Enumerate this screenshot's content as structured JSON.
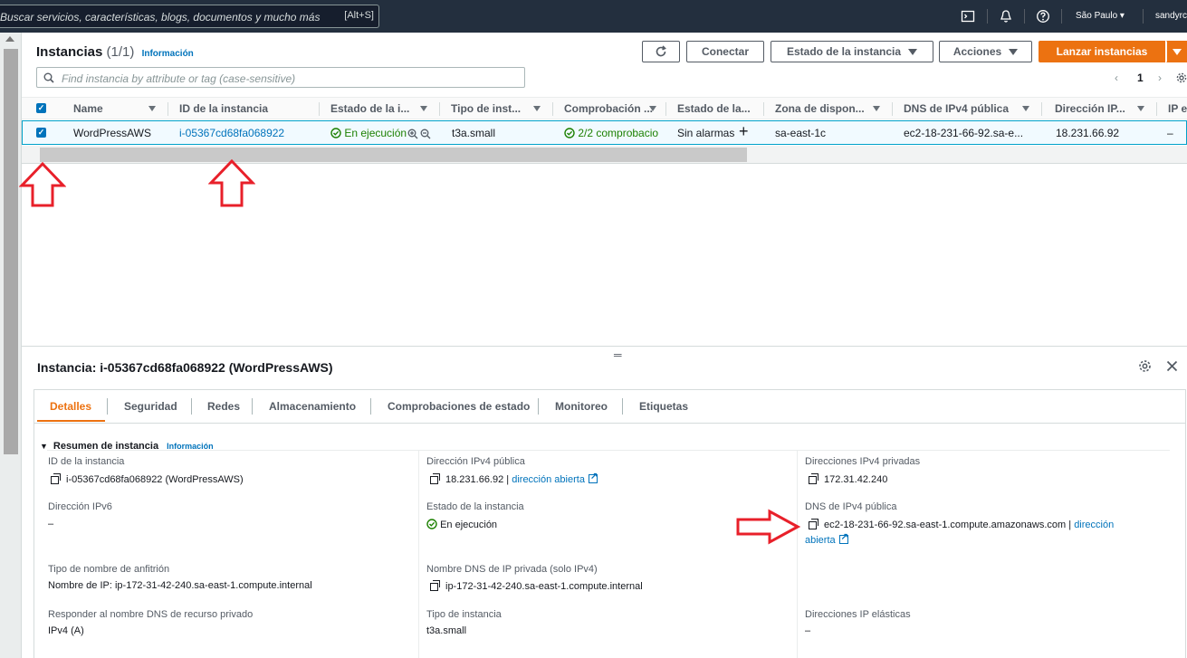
{
  "topbar": {
    "search_placeholder": "Buscar servicios, características, blogs, documentos y mucho más",
    "search_shortcut": "[Alt+S]",
    "region": "São Paulo ▾",
    "user": "sandyrc"
  },
  "header": {
    "title": "Instancias",
    "count": "(1/1)",
    "info": "Información",
    "buttons": {
      "refresh": "⟳",
      "connect": "Conectar",
      "instance_state": "Estado de la instancia",
      "actions": "Acciones",
      "launch": "Lanzar instancias"
    },
    "filter_placeholder": "Find instancia by attribute or tag (case-sensitive)",
    "page": "1"
  },
  "table": {
    "columns": [
      "Name",
      "ID de la instancia",
      "Estado de la i...",
      "Tipo de inst...",
      "Comprobación ...",
      "Estado de la...",
      "Zona de dispon...",
      "DNS de IPv4 pública",
      "Dirección IP...",
      "IP e"
    ],
    "row": {
      "name": "WordPressAWS",
      "id": "i-05367cd68fa068922",
      "state": "En ejecución",
      "type": "t3a.small",
      "checks": "2/2 comprobacio",
      "alarms": "Sin alarmas",
      "zone": "sa-east-1c",
      "dns": "ec2-18-231-66-92.sa-e...",
      "ip": "18.231.66.92",
      "ip_extra": "–"
    }
  },
  "details": {
    "title": "Instancia: i-05367cd68fa068922 (WordPressAWS)",
    "tabs": [
      "Detalles",
      "Seguridad",
      "Redes",
      "Almacenamiento",
      "Comprobaciones de estado",
      "Monitoreo",
      "Etiquetas"
    ],
    "section_title": "Resumen de instancia",
    "section_info": "Información",
    "fields": {
      "id_label": "ID de la instancia",
      "id_value": "i-05367cd68fa068922 (WordPressAWS)",
      "pub_ip_label": "Dirección IPv4 pública",
      "pub_ip_value": "18.231.66.92",
      "open_address": "dirección abierta",
      "priv_ip_label": "Direcciones IPv4 privadas",
      "priv_ip_value": "172.31.42.240",
      "ipv6_label": "Dirección IPv6",
      "ipv6_value": "–",
      "state_label": "Estado de la instancia",
      "state_value": "En ejecución",
      "dns_label": "DNS de IPv4 pública",
      "dns_value": "ec2-18-231-66-92.sa-east-1.compute.amazonaws.com",
      "dns_open_1": "dirección",
      "dns_open_2": "abierta",
      "hostname_label": "Tipo de nombre de anfitrión",
      "hostname_value": "Nombre de IP: ip-172-31-42-240.sa-east-1.compute.internal",
      "privdns_label": "Nombre DNS de IP privada (solo IPv4)",
      "privdns_value": "ip-172-31-42-240.sa-east-1.compute.internal",
      "respond_label": "Responder al nombre DNS de recurso privado",
      "respond_value": "IPv4 (A)",
      "type_label": "Tipo de instancia",
      "type_value": "t3a.small",
      "eip_label": "Direcciones IP elásticas",
      "eip_value": "–"
    }
  },
  "colors": {
    "topbar": "#232f3e",
    "accent": "#ec7211",
    "link": "#0073bb",
    "success": "#1d8102",
    "annotation": "#e8202a"
  }
}
